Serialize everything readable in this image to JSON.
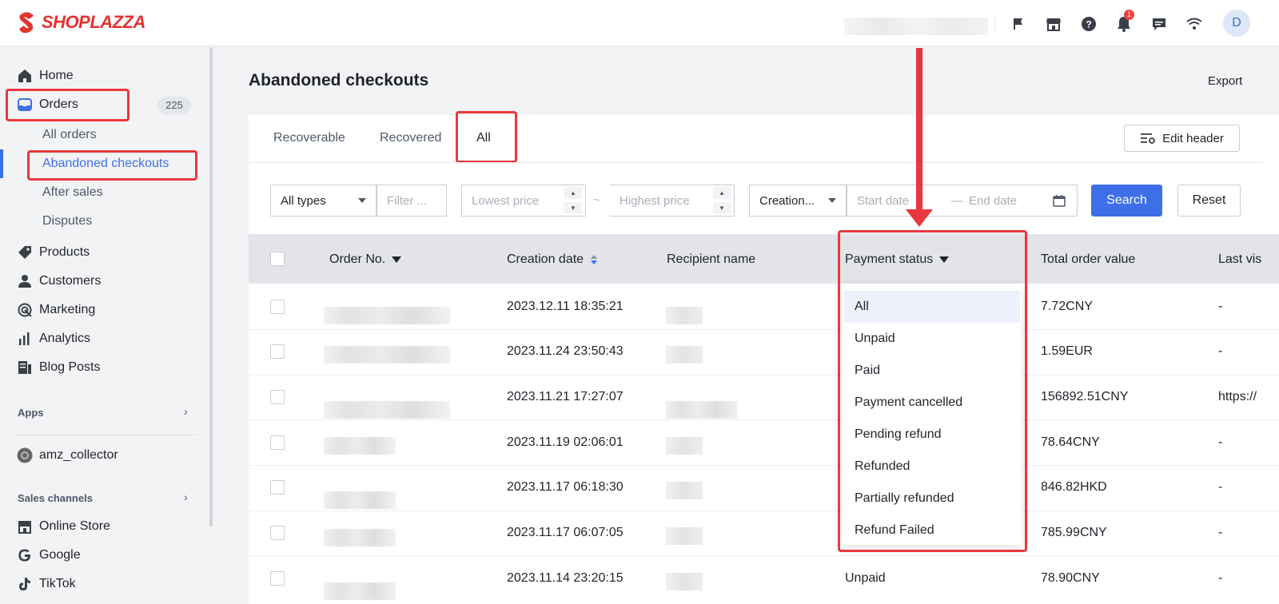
{
  "brand": {
    "name": "SHOPLAZZA",
    "color": "#e5322d"
  },
  "topbar": {
    "icons": [
      "flag-icon",
      "store-icon",
      "help-icon",
      "bell-icon",
      "chat-icon",
      "wifi-icon"
    ],
    "notification_count": "1",
    "avatar_letter": "D"
  },
  "sidebar": {
    "home": "Home",
    "orders": "Orders",
    "orders_count": "225",
    "all_orders": "All orders",
    "abandoned_checkouts": "Abandoned checkouts",
    "after_sales": "After sales",
    "disputes": "Disputes",
    "products": "Products",
    "customers": "Customers",
    "marketing": "Marketing",
    "analytics": "Analytics",
    "blog_posts": "Blog Posts",
    "apps": "Apps",
    "app_item": "amz_collector",
    "sales_channels": "Sales channels",
    "online_store": "Online Store",
    "google": "Google",
    "tiktok": "TikTok"
  },
  "page": {
    "title": "Abandoned checkouts",
    "export": "Export",
    "tabs": [
      "Recoverable",
      "Recovered",
      "All"
    ],
    "active_tab": "All",
    "edit_header": "Edit header"
  },
  "filters": {
    "type": "All types",
    "filter_placeholder": "Filter ...",
    "lowest_price": "Lowest price",
    "price_separator": "~",
    "highest_price": "Highest price",
    "date_type": "Creation...",
    "start_date": "Start date",
    "date_separator": "—",
    "end_date": "End date",
    "search": "Search",
    "reset": "Reset"
  },
  "table": {
    "headers": {
      "order_no": "Order No.",
      "creation_date": "Creation date",
      "recipient": "Recipient name",
      "payment_status": "Payment status",
      "total": "Total order value",
      "last_visit": "Last vis"
    },
    "rows": [
      {
        "date": "2023.12.11 18:35:21",
        "total": "7.72CNY",
        "last": "-"
      },
      {
        "date": "2023.11.24 23:50:43",
        "total": "1.59EUR",
        "last": "-"
      },
      {
        "date": "2023.11.21 17:27:07",
        "total": "156892.51CNY",
        "last": "https://"
      },
      {
        "date": "2023.11.19 02:06:01",
        "total": "78.64CNY",
        "last": "-"
      },
      {
        "date": "2023.11.17 06:18:30",
        "total": "846.82HKD",
        "last": "-"
      },
      {
        "date": "2023.11.17 06:07:05",
        "total": "785.99CNY",
        "last": "-"
      },
      {
        "date": "2023.11.14 23:20:15",
        "status": "Unpaid",
        "total": "78.90CNY",
        "last": "-"
      }
    ]
  },
  "payment_dropdown": {
    "options": [
      "All",
      "Unpaid",
      "Paid",
      "Payment cancelled",
      "Pending refund",
      "Refunded",
      "Partially refunded",
      "Refund Failed"
    ],
    "selected": "All"
  },
  "colors": {
    "accent": "#3f6fe8",
    "highlight": "#e8383d"
  }
}
